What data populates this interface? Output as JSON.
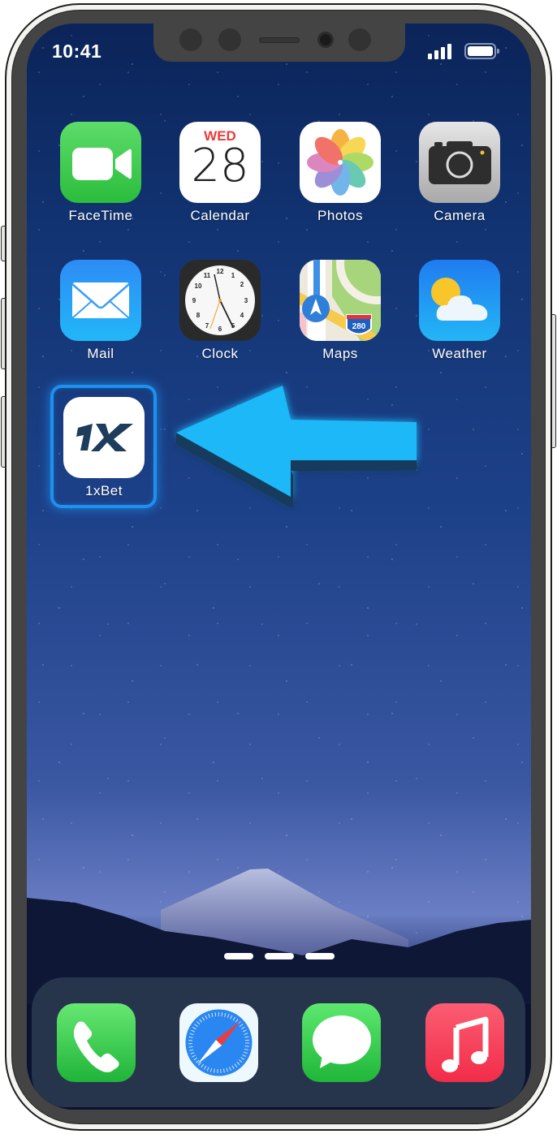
{
  "status_bar": {
    "time": "10:41",
    "signal_icon": "cellular-signal-icon",
    "battery_icon": "battery-full-icon"
  },
  "home_screen": {
    "apps": [
      {
        "name": "FaceTime",
        "icon": "video-camera-icon",
        "color": "#34c759"
      },
      {
        "name": "Calendar",
        "icon": "calendar-icon",
        "day": "WED",
        "date": "28",
        "accent": "#ec3b3b"
      },
      {
        "name": "Photos",
        "icon": "photos-flower-icon"
      },
      {
        "name": "Camera",
        "icon": "camera-icon"
      },
      {
        "name": "Mail",
        "icon": "envelope-icon",
        "color": "#2d8cf5"
      },
      {
        "name": "Clock",
        "icon": "clock-face-icon"
      },
      {
        "name": "Maps",
        "icon": "map-icon",
        "highway_shield": "280"
      },
      {
        "name": "Weather",
        "icon": "sun-cloud-icon",
        "color": "#1f7cf0"
      },
      {
        "name": "1xBet",
        "icon": "1x-logo-icon",
        "logo_text": "1X",
        "highlighted": true,
        "highlight_color": "#1e90f0"
      }
    ],
    "pointer_arrow": {
      "icon": "left-arrow-icon",
      "color": "#1ab8f8",
      "points_to": "1xBet"
    },
    "page_indicator_count": 3
  },
  "dock": {
    "apps": [
      {
        "name": "Phone",
        "icon": "phone-handset-icon"
      },
      {
        "name": "Safari",
        "icon": "compass-icon"
      },
      {
        "name": "Messages",
        "icon": "speech-bubble-icon"
      },
      {
        "name": "Music",
        "icon": "music-note-icon"
      }
    ]
  }
}
